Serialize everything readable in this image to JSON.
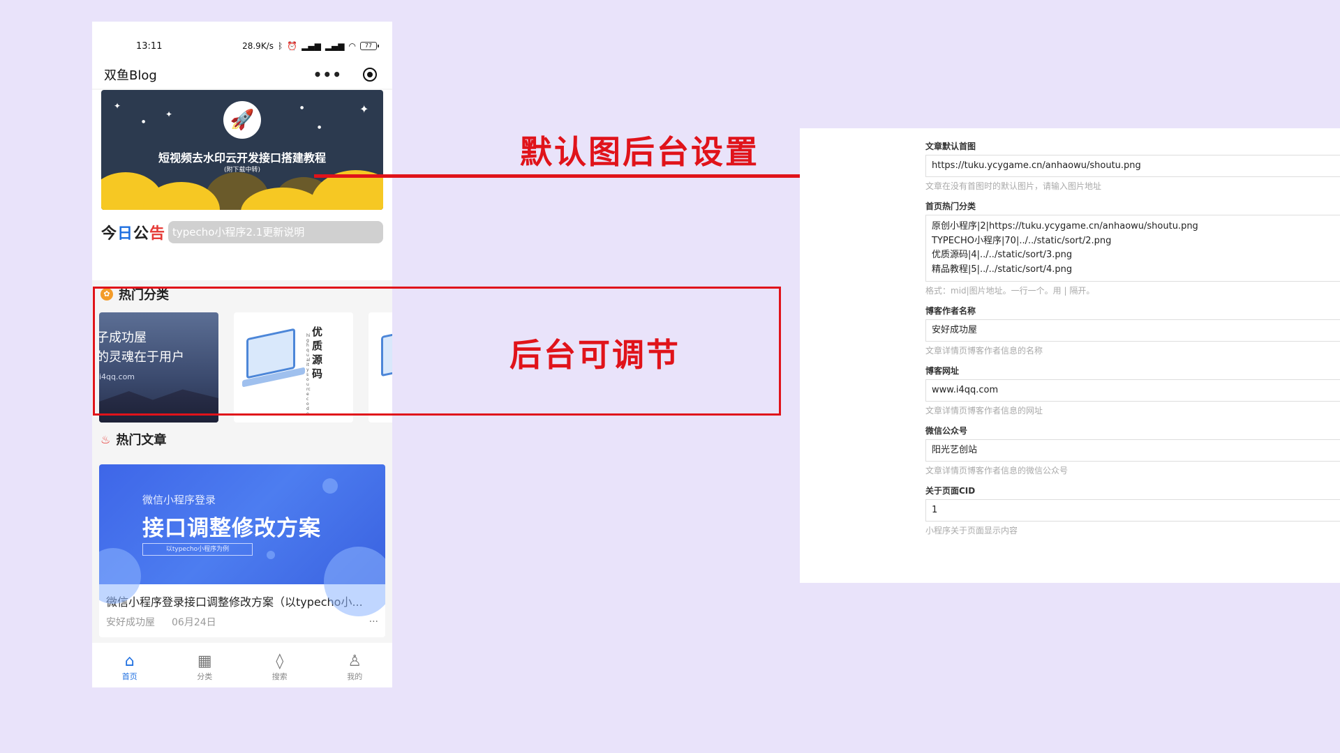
{
  "phone": {
    "status": {
      "time": "13:11",
      "net_speed": "28.9K/s",
      "icons": [
        "bluetooth-icon",
        "alarm-icon",
        "signal-icon",
        "signal-icon",
        "wifi-icon"
      ],
      "battery": "77"
    },
    "navbar": {
      "title": "双鱼Blog"
    },
    "banner": {
      "title": "短视频去水印云开发接口搭建教程",
      "subtitle": "(附下载中转)"
    },
    "notice": {
      "logo_chars": [
        "今",
        "日",
        "公",
        "告"
      ],
      "text": "typecho小程序2.1更新说明"
    },
    "hot_categories": {
      "heading": "热门分类",
      "card1": {
        "line1": "子成功屋",
        "line2": "的灵魂在于用户",
        "line3": "i4qq.com"
      },
      "card2": {
        "vertical": "优质源码",
        "small": "high quality source code"
      }
    },
    "hot_articles": {
      "heading": "热门文章",
      "article": {
        "img_line1": "微信小程序登录",
        "img_line2": "接口调整修改方案",
        "img_line3": "以typecho小程序为例",
        "title": "微信小程序登录接口调整修改方案（以typecho小...",
        "author": "安好成功屋",
        "date": "06月24日",
        "more": "···"
      }
    },
    "tabbar": [
      {
        "label": "首页",
        "icon": "home-icon"
      },
      {
        "label": "分类",
        "icon": "grid-icon"
      },
      {
        "label": "搜索",
        "icon": "flame-icon"
      },
      {
        "label": "我的",
        "icon": "user-icon"
      }
    ]
  },
  "annotations": {
    "default_image": "默认图后台设置",
    "adjustable": "后台可调节"
  },
  "admin": {
    "default_image": {
      "label": "文章默认首图",
      "value": "https://tuku.ycygame.cn/anhaowu/shoutu.png",
      "desc": "文章在没有首图时的默认图片，请输入图片地址"
    },
    "hot_categories": {
      "label": "首页热门分类",
      "lines": [
        "原创小程序|2|https://tuku.ycygame.cn/anhaowu/shoutu.png",
        "TYPECHO小程序|70|../../static/sort/2.png",
        "优质源码|4|../../static/sort/3.png",
        "精品教程|5|../../static/sort/4.png"
      ],
      "desc": "格式：mid|图片地址。一行一个。用 | 隔开。"
    },
    "author_name": {
      "label": "博客作者名称",
      "value": "安好成功屋",
      "desc": "文章详情页博客作者信息的名称"
    },
    "blog_url": {
      "label": "博客网址",
      "value": "www.i4qq.com",
      "desc": "文章详情页博客作者信息的网址"
    },
    "wechat": {
      "label": "微信公众号",
      "value": "阳光艺创站",
      "desc": "文章详情页博客作者信息的微信公众号"
    },
    "about_cid": {
      "label": "关于页面CID",
      "value": "1",
      "desc": "小程序关于页面显示内容"
    }
  }
}
